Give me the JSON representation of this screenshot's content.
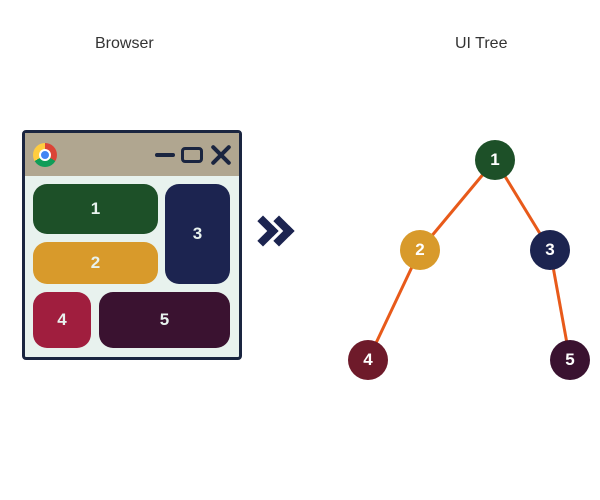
{
  "labels": {
    "browser": "Browser",
    "tree": "UI Tree"
  },
  "boxes": {
    "b1": "1",
    "b2": "2",
    "b3": "3",
    "b4": "4",
    "b5": "5"
  },
  "nodes": {
    "n1": "1",
    "n2": "2",
    "n3": "3",
    "n4": "4",
    "n5": "5"
  },
  "colors": {
    "node1": "#1d5028",
    "node2": "#d89a2b",
    "node3": "#1c2450",
    "node4": "#6e1a2a",
    "node5": "#3a1230",
    "edge": "#e85a1a"
  },
  "tree_structure": {
    "root": 1,
    "edges": [
      [
        1,
        2
      ],
      [
        1,
        3
      ],
      [
        2,
        4
      ],
      [
        3,
        5
      ]
    ]
  }
}
